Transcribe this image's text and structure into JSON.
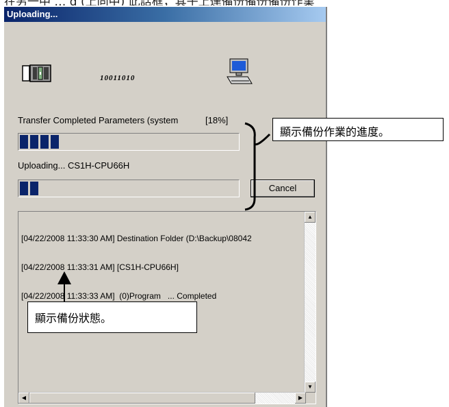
{
  "top_caption": "在另一中 … g (上同中) 此話框，其子上達備份備份備份作業",
  "window": {
    "title": "Uploading...",
    "transfer_bits": "10011010"
  },
  "progress_main": {
    "label": "Transfer Completed Parameters (system",
    "percent_label": "[18%]",
    "progress": 0.18
  },
  "progress_sub": {
    "label": "Uploading... CS1H-CPU66H",
    "progress": 0.08
  },
  "cancel_label": "Cancel",
  "log": {
    "lines": [
      "[04/22/2008 11:33:30 AM] Destination Folder (D:\\Backup\\08042",
      "[04/22/2008 11:33:31 AM] [CS1H-CPU66H]",
      "[04/22/2008 11:33:33 AM]  (0)Program   ... Completed"
    ]
  },
  "annotations": {
    "progress_callout": "顯示備份作業的進度。",
    "status_callout": "顯示備份狀態。"
  },
  "icons": [
    "plc-icon",
    "computer-icon",
    "scroll-up-icon",
    "scroll-down-icon",
    "scroll-left-icon",
    "scroll-right-icon"
  ]
}
